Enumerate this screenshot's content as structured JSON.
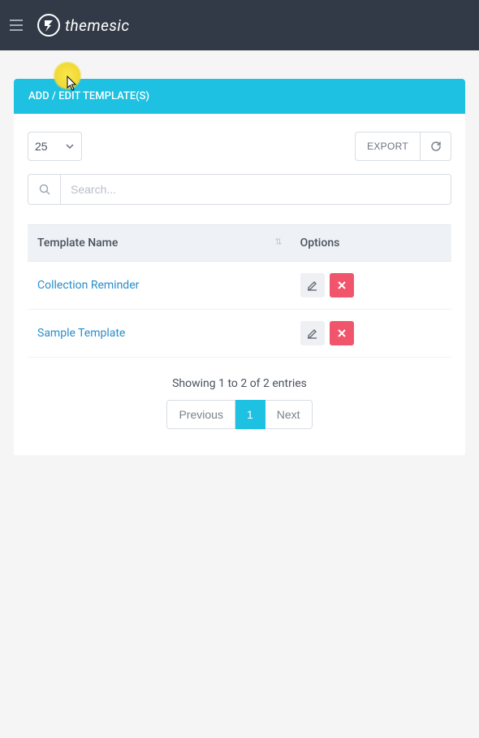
{
  "header": {
    "brand": "themesic"
  },
  "panel": {
    "title": "ADD / EDIT TEMPLATE(S)"
  },
  "toolbar": {
    "page_length": "25",
    "export_label": "EXPORT"
  },
  "search": {
    "placeholder": "Search..."
  },
  "table": {
    "columns": {
      "name": "Template Name",
      "options": "Options"
    },
    "rows": [
      {
        "name": "Collection Reminder"
      },
      {
        "name": "Sample Template"
      }
    ]
  },
  "pagination": {
    "info": "Showing 1 to 2 of 2 entries",
    "prev": "Previous",
    "page": "1",
    "next": "Next"
  }
}
